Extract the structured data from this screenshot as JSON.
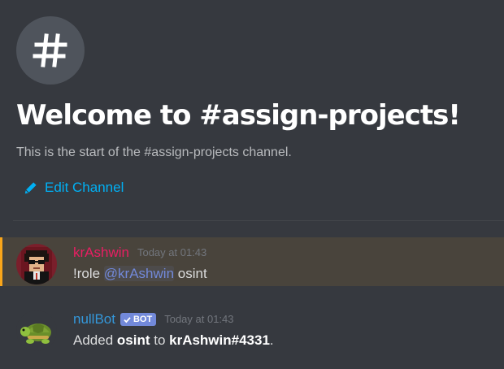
{
  "colors": {
    "background": "#36393f",
    "highlight_bg": "#49443c",
    "highlight_border": "#faa61a",
    "link": "#00b0f4",
    "mention": "#7289da",
    "user_krashwin": "#e91e63",
    "user_nullbot": "#3498db"
  },
  "welcome": {
    "icon": "hash-icon",
    "title": "Welcome to #assign-projects!",
    "description": "This is the start of the #assign-projects channel.",
    "edit_icon": "pencil-icon",
    "edit_label": "Edit Channel"
  },
  "messages": [
    {
      "avatar": "pixel-avatar",
      "username": "krAshwin",
      "timestamp": "Today at 01:43",
      "content": {
        "prefix": "!role ",
        "mention": "@krAshwin",
        "suffix": " osint"
      }
    },
    {
      "avatar": "turtle-avatar",
      "username": "nullBot",
      "badge": "BOT",
      "timestamp": "Today at 01:43",
      "content": {
        "part1": "Added ",
        "role": "osint",
        "part2": " to ",
        "user": "krAshwin#4331",
        "part3": "."
      }
    }
  ]
}
